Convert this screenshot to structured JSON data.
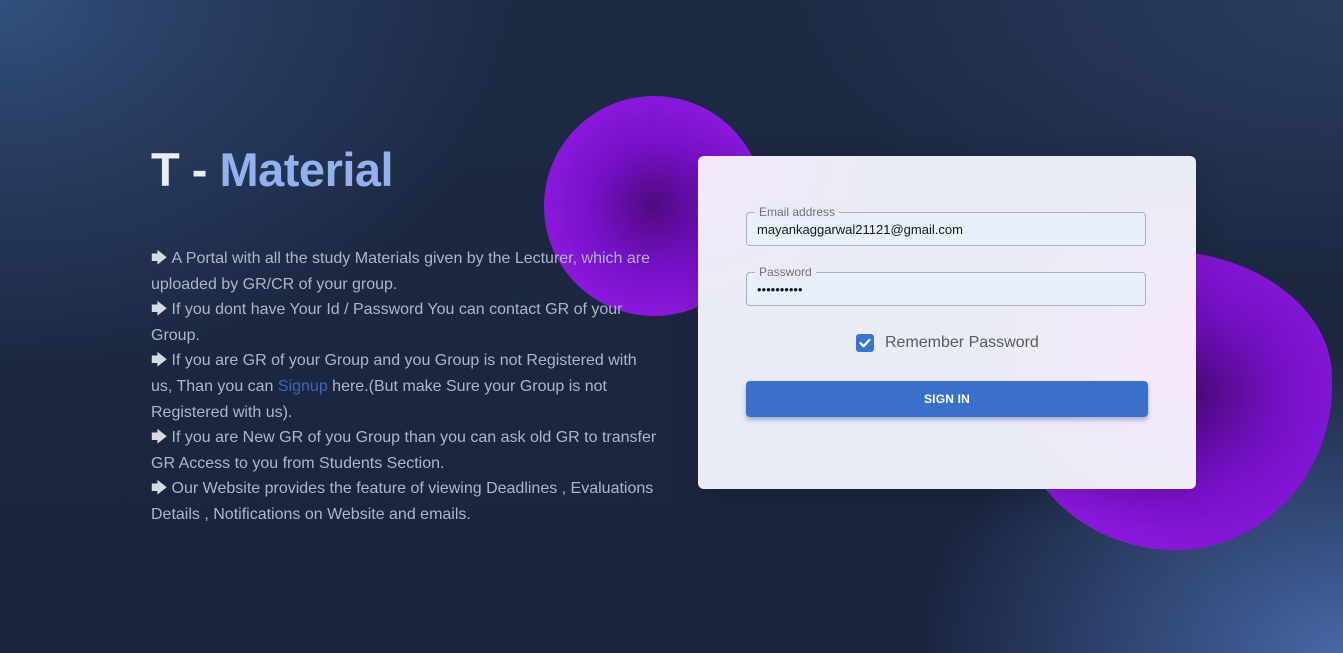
{
  "hero": {
    "title_prefix": "T - ",
    "title_accent": "Material"
  },
  "features": {
    "arrow": "🡆",
    "items": [
      "A Portal with all the study Materials given by the Lecturer, which are uploaded by GR/CR of your group.",
      "If you dont have Your Id / Password You can contact GR of your Group."
    ],
    "signup_item": {
      "before": "If you are GR of your Group and you Group is not Registered with us, Than you can ",
      "link": "Signup",
      "after": " here.(But make Sure your Group is not Registered with us)."
    },
    "items_after": [
      "If you are New GR of you Group than you can ask old GR to transfer GR Access to you from Students Section.",
      "Our Website provides the feature of viewing Deadlines , Evaluations Details , Notifications on Website and emails."
    ]
  },
  "login": {
    "email_label": "Email address",
    "email_value": "mayankaggarwal21121@gmail.com",
    "password_label": "Password",
    "password_value": "••••••••••",
    "remember_label": "Remember Password",
    "remember_checked": true,
    "signin_label": "SIGN IN"
  },
  "colors": {
    "accent": "#93b1ef",
    "button": "#3a70cb",
    "blob": "#8a18dc",
    "link": "#3e66b3"
  },
  "icons": {
    "arrow": "arrow-right-icon",
    "check": "check-icon"
  }
}
